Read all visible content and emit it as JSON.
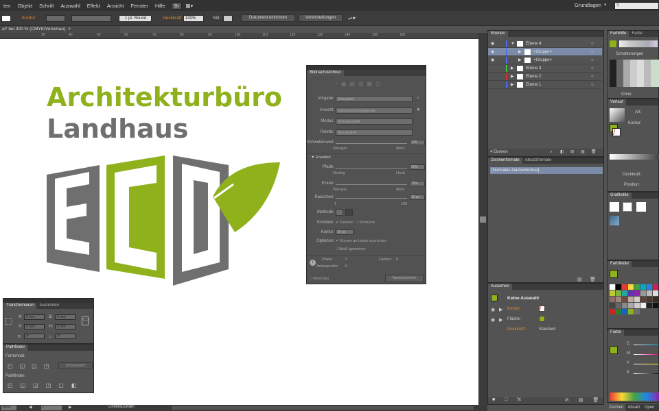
{
  "menubar": {
    "items": [
      "ten",
      "Objekt",
      "Schrift",
      "Auswahl",
      "Effekt",
      "Ansicht",
      "Fenster",
      "Hilfe"
    ],
    "workspace": "Grundlagen"
  },
  "control": {
    "kontur": "Kontur:",
    "stroke_style": "1 pt. Round",
    "deckkraft": "Deckkraft:",
    "opacity": "100%",
    "stil": "Stil:",
    "doc_setup": "Dokument einrichten",
    "prefs": "Voreinstellungen"
  },
  "document": {
    "tab": "ai* bei 300 % (CMYK/Vorschau)"
  },
  "ruler": [
    "30",
    "40",
    "50",
    "60",
    "70",
    "80",
    "90",
    "100",
    "110",
    "120",
    "130",
    "140",
    "150",
    "160"
  ],
  "logo": {
    "line1": "Architekturbüro",
    "line2": "Landhaus",
    "letters": [
      "E",
      "C",
      "O"
    ],
    "green": "#8fb21c",
    "gray": "#6f6f6f"
  },
  "bildnachzeichner": {
    "title": "Bildnachzeichner",
    "vorgabe_label": "Vorgabe:",
    "vorgabe": "[Vorgabe]",
    "ansicht_label": "Ansicht:",
    "ansicht": "Nachzeichnerergebnis",
    "modus_label": "Modus:",
    "modus": "Schwarzweiß",
    "palette_label": "Palette:",
    "palette": "Beschränkt",
    "schwellenwert_label": "Schwellenwert:",
    "schwellenwert": "128",
    "weniger": "Weniger",
    "mehr": "Mehr",
    "erweitert": "Erweitert",
    "pfade_label": "Pfade:",
    "pfade": "50%",
    "niedrig": "Niedrig",
    "hoch": "Hoch",
    "ecken_label": "Ecken:",
    "ecken": "75%",
    "weniger2": "Weniger",
    "mehr2": "Mehr",
    "rauschen_label": "Rauschen:",
    "rauschen": "25 px",
    "r_min": "1",
    "r_max": "100",
    "methode_label": "Methode:",
    "erstellen_label": "Erstellen:",
    "flaechen": "Flächen",
    "konturen": "Konturen",
    "kontur_label": "Kontur:",
    "kontur_val": "10 px",
    "optionen_label": "Optionen:",
    "kurven": "Kurven an Linien ausrichten",
    "weiss": "Weiß ignorieren",
    "pfade_stat": "Pfade:",
    "pfade_n": "0",
    "farben_stat": "Farben:",
    "farben_n": "0",
    "anker_stat": "Ankerpunkte:",
    "anker_n": "0",
    "vorschau": "Vorschau",
    "button": "Nachzeichnen"
  },
  "transform": {
    "tab1": "Transformieren",
    "tab2": "Ausrichten",
    "x_label": "X:",
    "x": "0 mm",
    "y_label": "Y:",
    "y": "0 mm",
    "b_label": "B:",
    "b": "0 mm",
    "h_label": "H:",
    "h": "0 mm",
    "rot": "0°",
    "shear": "0°"
  },
  "pathfinder": {
    "tab": "Pathfinder",
    "formmodi": "Formmodi:",
    "umwandeln": "Umwandeln",
    "pathfinder_label": "Pathfinder:"
  },
  "layers": {
    "tab": "Ebenen",
    "rows": [
      {
        "name": "Ebene 4",
        "color": "#4b6cf0"
      },
      {
        "name": "<Gruppe>",
        "color": "#4b6cf0"
      },
      {
        "name": "<Gruppe>",
        "color": "#4b6cf0"
      },
      {
        "name": "Ebene 3",
        "color": "#3cc83c"
      },
      {
        "name": "Ebene 2",
        "color": "#e03030"
      },
      {
        "name": "Ebene 1",
        "color": "#4b6cf0"
      }
    ],
    "count": "4 Ebenen"
  },
  "zeichen": {
    "tab1": "Zeichenformate",
    "tab2": "Absatzformate",
    "item": "[Normales Zeichenformat]"
  },
  "aussehen": {
    "tab": "Aussehen",
    "title": "Keine Auswahl",
    "kontur": "Kontur:",
    "flaeche": "Fläche:",
    "deckkraft": "Deckkraft:",
    "standard": "Standard"
  },
  "farbhilfe": {
    "tab1": "Farbhilfe",
    "tab2": "Farbe",
    "schatt": "Schattierungen",
    "ohne": "Ohne"
  },
  "verlauf": {
    "tab": "Verlauf",
    "art": "Art:",
    "kontur": "Kontur:",
    "deckkraft": "Deckkraft:",
    "position": "Position:"
  },
  "grafikstile": {
    "tab": "Grafikstile"
  },
  "farbfelder": {
    "tab": "Farbfelder"
  },
  "farbe": {
    "tab": "Farbe",
    "c": "C",
    "m": "M",
    "y": "Y",
    "k": "K"
  },
  "bottomtabs": {
    "zeichen": "Zeichen",
    "absatz": "Absatz",
    "opentype": "Open"
  },
  "status": {
    "zoom": "300%",
    "page": "1",
    "tool": "Direktauswahl"
  }
}
